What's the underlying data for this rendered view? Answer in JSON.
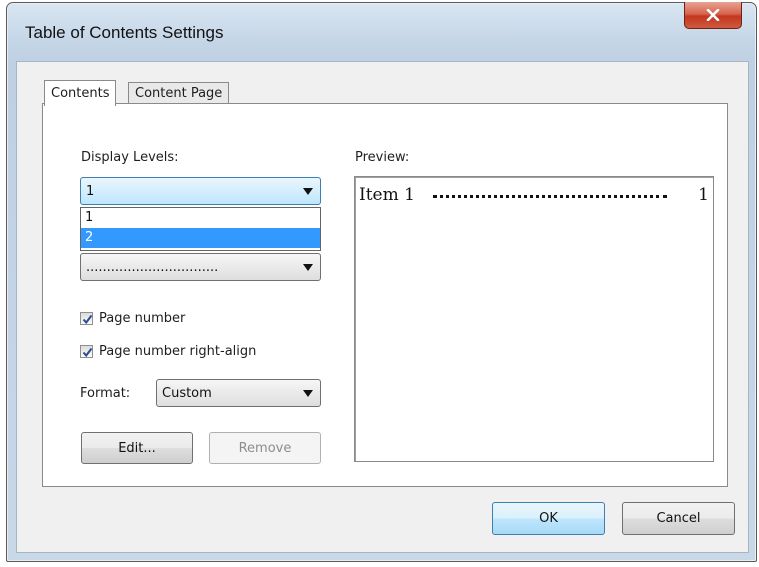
{
  "window": {
    "title": "Table of Contents Settings"
  },
  "tabs": [
    {
      "label": "Contents",
      "active": true
    },
    {
      "label": "Content Page",
      "active": false
    }
  ],
  "contents": {
    "display_levels_label": "Display Levels:",
    "display_levels_value": "1",
    "display_levels_options": [
      "1",
      "2"
    ],
    "display_levels_highlighted": "2",
    "leader_value": "................................",
    "page_number_label": "Page number",
    "page_number_checked": true,
    "right_align_label": "Page number right-align",
    "right_align_checked": true,
    "format_label": "Format:",
    "format_value": "Custom",
    "edit_button": "Edit...",
    "remove_button": "Remove"
  },
  "preview": {
    "label": "Preview:",
    "item_text": "Item 1",
    "page_number": "1"
  },
  "footer": {
    "ok_button": "OK",
    "cancel_button": "Cancel"
  },
  "colors": {
    "selection": "#3399ff",
    "close_button": "#c2371f",
    "focus_border": "#3c7fb1"
  }
}
